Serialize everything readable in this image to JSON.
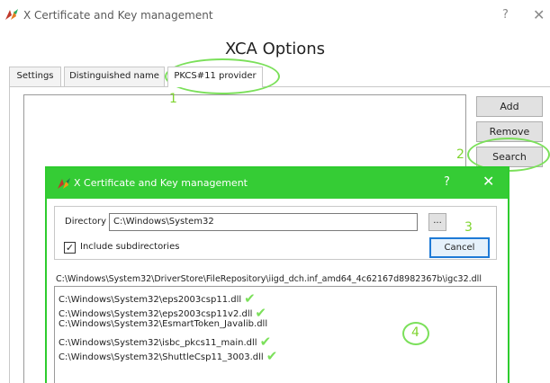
{
  "main_window": {
    "title": "X Certificate and Key management",
    "help_button": "?",
    "close_button": "✕"
  },
  "dialog_heading": "XCA Options",
  "tabs": [
    {
      "label": "Settings"
    },
    {
      "label": "Distinguished name"
    },
    {
      "label": "PKCS#11 provider"
    }
  ],
  "side_buttons": {
    "add": "Add",
    "remove": "Remove",
    "search": "Search"
  },
  "annotations": {
    "n1": "1",
    "n2": "2",
    "n3": "3",
    "n4": "4",
    "color": "#7be05a"
  },
  "search_dialog": {
    "title": "X Certificate and Key management",
    "help_button": "?",
    "close_button": "✕",
    "titlebar_color": "#35cc35",
    "directory_label": "Directory",
    "directory_value": "C:\\Windows\\System32",
    "browse_label": "...",
    "include_subdirs_label": "Include subdirectories",
    "include_subdirs_checked": "✓",
    "cancel_label": "Cancel",
    "current_path": "C:\\Windows\\System32\\DriverStore\\FileRepository\\iigd_dch.inf_amd64_4c62167d8982367b\\igc32.dll",
    "results": [
      {
        "path": "C:\\Windows\\System32\\eps2003csp11.dll",
        "checked": true
      },
      {
        "path": "C:\\Windows\\System32\\eps2003csp11v2.dll",
        "checked": true
      },
      {
        "path": "C:\\Windows\\System32\\EsmartToken_Javalib.dll",
        "checked": false
      },
      {
        "path": "C:\\Windows\\System32\\isbc_pkcs11_main.dll",
        "checked": true
      },
      {
        "path": "C:\\Windows\\System32\\ShuttleCsp11_3003.dll",
        "checked": true
      }
    ]
  }
}
